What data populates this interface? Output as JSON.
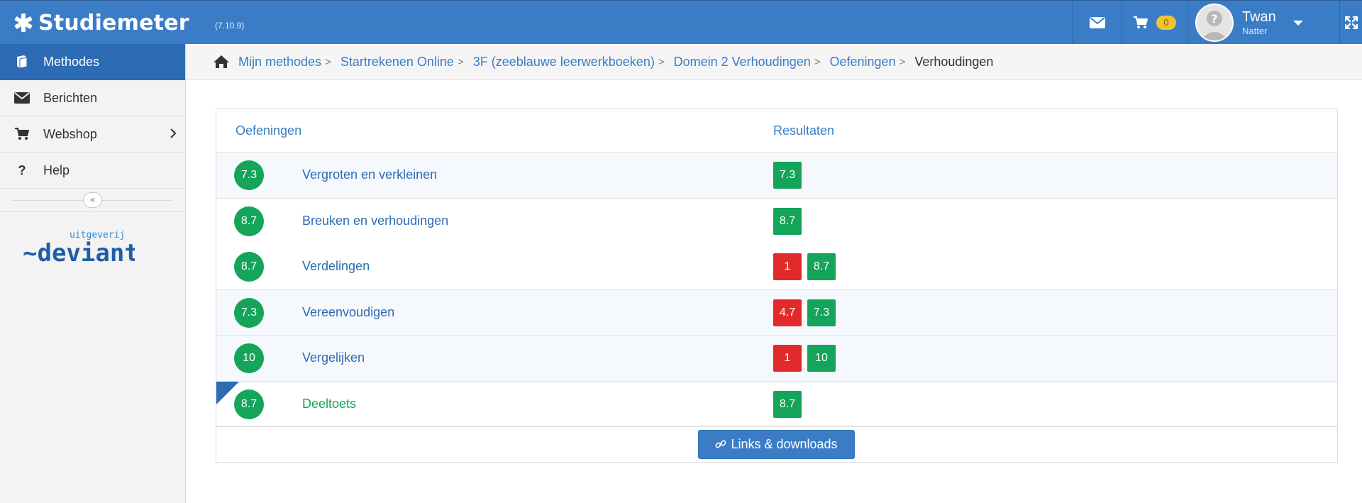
{
  "app": {
    "brand": "Studiemeter",
    "version": "(7.10.9)",
    "cart_count": "0",
    "user_first": "Twan",
    "user_last": "Natter"
  },
  "colors": {
    "topbar": "#3a7cc6",
    "active": "#2d6bb5",
    "good": "#14a45a",
    "bad": "#e32a2a",
    "badge": "#f3c232"
  },
  "icons": {
    "mail": "envelope-icon",
    "cart": "cart-icon",
    "expand": "expand-icon",
    "home": "home-icon",
    "link": "link-icon"
  },
  "sidebar": {
    "items": [
      {
        "label": "Methodes",
        "icon": "book-icon",
        "active": true
      },
      {
        "label": "Berichten",
        "icon": "envelope-icon"
      },
      {
        "label": "Webshop",
        "icon": "cart-icon"
      },
      {
        "label": "Help",
        "icon": "question-icon"
      }
    ],
    "logo_small": "uitgeverij",
    "logo_big": "~deviant"
  },
  "breadcrumb": {
    "items": [
      "Mijn methodes",
      "Startrekenen Online",
      "3F (zeeblauwe leerwerkboeken)",
      "Domein 2 Verhoudingen",
      "Oefeningen"
    ],
    "separator": ">",
    "current": "Verhoudingen"
  },
  "table": {
    "col_exercises": "Oefeningen",
    "col_results": "Resultaten",
    "rows": [
      {
        "score": "7.3",
        "title": "Vergroten en verkleinen",
        "results": [
          {
            "value": "7.3",
            "status": "good"
          }
        ]
      },
      {
        "score": "8.7",
        "title": "Breuken en verhoudingen",
        "results": [
          {
            "value": "8.7",
            "status": "good"
          }
        ]
      },
      {
        "score": "8.7",
        "title": "Verdelingen",
        "results": [
          {
            "value": "1",
            "status": "bad"
          },
          {
            "value": "8.7",
            "status": "good"
          }
        ]
      },
      {
        "score": "7.3",
        "title": "Vereenvoudigen",
        "results": [
          {
            "value": "4.7",
            "status": "bad"
          },
          {
            "value": "7.3",
            "status": "good"
          }
        ]
      },
      {
        "score": "10",
        "title": "Vergelijken",
        "results": [
          {
            "value": "1",
            "status": "bad"
          },
          {
            "value": "10",
            "status": "good"
          }
        ]
      },
      {
        "score": "8.7",
        "title": "Deeltoets",
        "results": [
          {
            "value": "8.7",
            "status": "good"
          }
        ]
      }
    ],
    "footer_button": "Links & downloads"
  }
}
